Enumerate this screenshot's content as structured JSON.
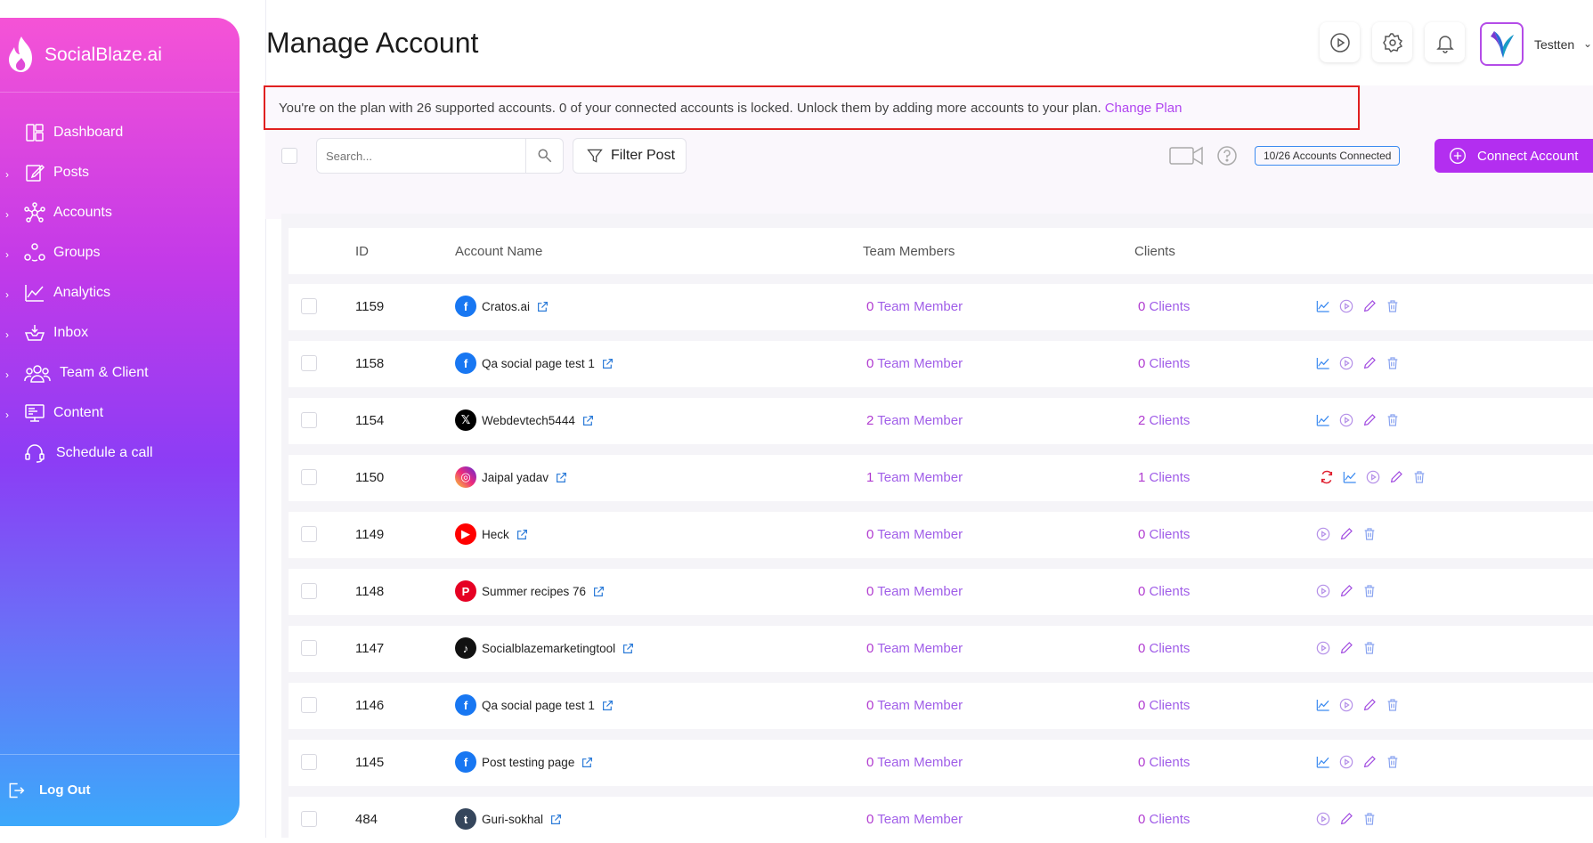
{
  "brand": {
    "name": "SocialBlaze.ai"
  },
  "sidebar": {
    "items": [
      {
        "label": "Dashboard",
        "icon": "dashboard-icon",
        "expandable": false
      },
      {
        "label": "Posts",
        "icon": "edit-icon",
        "expandable": true
      },
      {
        "label": "Accounts",
        "icon": "network-icon",
        "expandable": true
      },
      {
        "label": "Groups",
        "icon": "groups-icon",
        "expandable": true
      },
      {
        "label": "Analytics",
        "icon": "analytics-icon",
        "expandable": true
      },
      {
        "label": "Inbox",
        "icon": "inbox-icon",
        "expandable": true
      },
      {
        "label": "Team & Client",
        "icon": "team-icon",
        "expandable": true
      },
      {
        "label": "Content",
        "icon": "content-icon",
        "expandable": true
      },
      {
        "label": "Schedule a call",
        "icon": "headset-icon",
        "expandable": false
      }
    ],
    "logout_label": "Log Out"
  },
  "header": {
    "title": "Manage Account",
    "username": "Testten"
  },
  "notice": {
    "text": "You're on the plan with 26 supported accounts. 0 of your connected accounts is locked. Unlock them by adding more accounts to your plan.",
    "link": "Change Plan"
  },
  "toolbar": {
    "search_placeholder": "Search...",
    "filter_label": "Filter Post",
    "accounts_badge": "10/26 Accounts Connected",
    "connect_label": "Connect Account"
  },
  "table": {
    "headers": {
      "id": "ID",
      "account": "Account Name",
      "team": "Team Members",
      "clients": "Clients"
    },
    "rows": [
      {
        "id": "1159",
        "name": "Cratos.ai",
        "network": "facebook",
        "team_count": "0",
        "team_label": "Team Member",
        "client_count": "0",
        "client_label": "Clients",
        "actions": [
          "analytics-icon",
          "play-icon",
          "edit-icon",
          "trash-icon"
        ]
      },
      {
        "id": "1158",
        "name": "Qa social page test 1",
        "network": "facebook",
        "team_count": "0",
        "team_label": "Team Member",
        "client_count": "0",
        "client_label": "Clients",
        "actions": [
          "analytics-icon",
          "play-icon",
          "edit-icon",
          "trash-icon"
        ]
      },
      {
        "id": "1154",
        "name": "Webdevtech5444",
        "network": "x",
        "team_count": "2",
        "team_label": "Team Member",
        "client_count": "2",
        "client_label": "Clients",
        "actions": [
          "analytics-icon",
          "play-icon",
          "edit-icon",
          "trash-icon"
        ]
      },
      {
        "id": "1150",
        "name": "Jaipal yadav",
        "network": "instagram",
        "team_count": "1",
        "team_label": "Team Member",
        "client_count": "1",
        "client_label": "Clients",
        "actions": [
          "refresh-icon",
          "analytics-icon",
          "play-icon",
          "edit-icon",
          "trash-icon"
        ]
      },
      {
        "id": "1149",
        "name": "Heck",
        "network": "youtube",
        "team_count": "0",
        "team_label": "Team Member",
        "client_count": "0",
        "client_label": "Clients",
        "actions": [
          "play-icon",
          "edit-icon",
          "trash-icon"
        ]
      },
      {
        "id": "1148",
        "name": "Summer recipes 76",
        "network": "pinterest",
        "team_count": "0",
        "team_label": "Team Member",
        "client_count": "0",
        "client_label": "Clients",
        "actions": [
          "play-icon",
          "edit-icon",
          "trash-icon"
        ]
      },
      {
        "id": "1147",
        "name": "Socialblazemarketingtool",
        "network": "tiktok",
        "team_count": "0",
        "team_label": "Team Member",
        "client_count": "0",
        "client_label": "Clients",
        "actions": [
          "play-icon",
          "edit-icon",
          "trash-icon"
        ]
      },
      {
        "id": "1146",
        "name": "Qa social page test 1",
        "network": "facebook",
        "team_count": "0",
        "team_label": "Team Member",
        "client_count": "0",
        "client_label": "Clients",
        "actions": [
          "analytics-icon",
          "play-icon",
          "edit-icon",
          "trash-icon"
        ]
      },
      {
        "id": "1145",
        "name": "Post testing page",
        "network": "facebook",
        "team_count": "0",
        "team_label": "Team Member",
        "client_count": "0",
        "client_label": "Clients",
        "actions": [
          "analytics-icon",
          "play-icon",
          "edit-icon",
          "trash-icon"
        ]
      },
      {
        "id": "484",
        "name": "Guri-sokhal",
        "network": "tumblr",
        "team_count": "0",
        "team_label": "Team Member",
        "client_count": "0",
        "client_label": "Clients",
        "actions": [
          "play-icon",
          "edit-icon",
          "trash-icon"
        ]
      }
    ]
  },
  "colors": {
    "accent": "#b32ef0",
    "link": "#b146f0",
    "notice_border": "#e02020",
    "badge_border": "#3c8bf0"
  }
}
